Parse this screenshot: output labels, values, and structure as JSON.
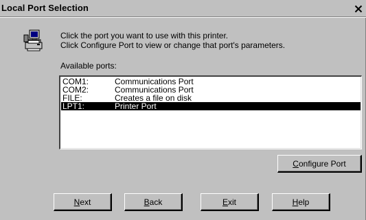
{
  "window": {
    "title": "Local Port Selection",
    "close_glyph": "✕"
  },
  "instructions": {
    "line1": "Click the port you want to use with this printer.",
    "line2": "Click Configure Port to view or change that port's parameters."
  },
  "ports": {
    "label": "Available ports:",
    "items": [
      {
        "port": "COM1:",
        "description": "Communications Port"
      },
      {
        "port": "COM2:",
        "description": "Communications Port"
      },
      {
        "port": "FILE:",
        "description": "Creates a file on disk"
      },
      {
        "port": "LPT1:",
        "description": "Printer Port"
      }
    ],
    "selected": "LPT1:"
  },
  "buttons": {
    "configure": {
      "mnemonic": "C",
      "rest": "onfigure Port"
    },
    "next": {
      "mnemonic": "N",
      "rest": "ext"
    },
    "back": {
      "mnemonic": "B",
      "rest": "ack"
    },
    "exit": {
      "mnemonic": "E",
      "rest": "xit"
    },
    "help": {
      "mnemonic": "H",
      "rest": "elp"
    }
  },
  "icons": {
    "header": "computer-printer-icon",
    "close": "close-icon"
  }
}
